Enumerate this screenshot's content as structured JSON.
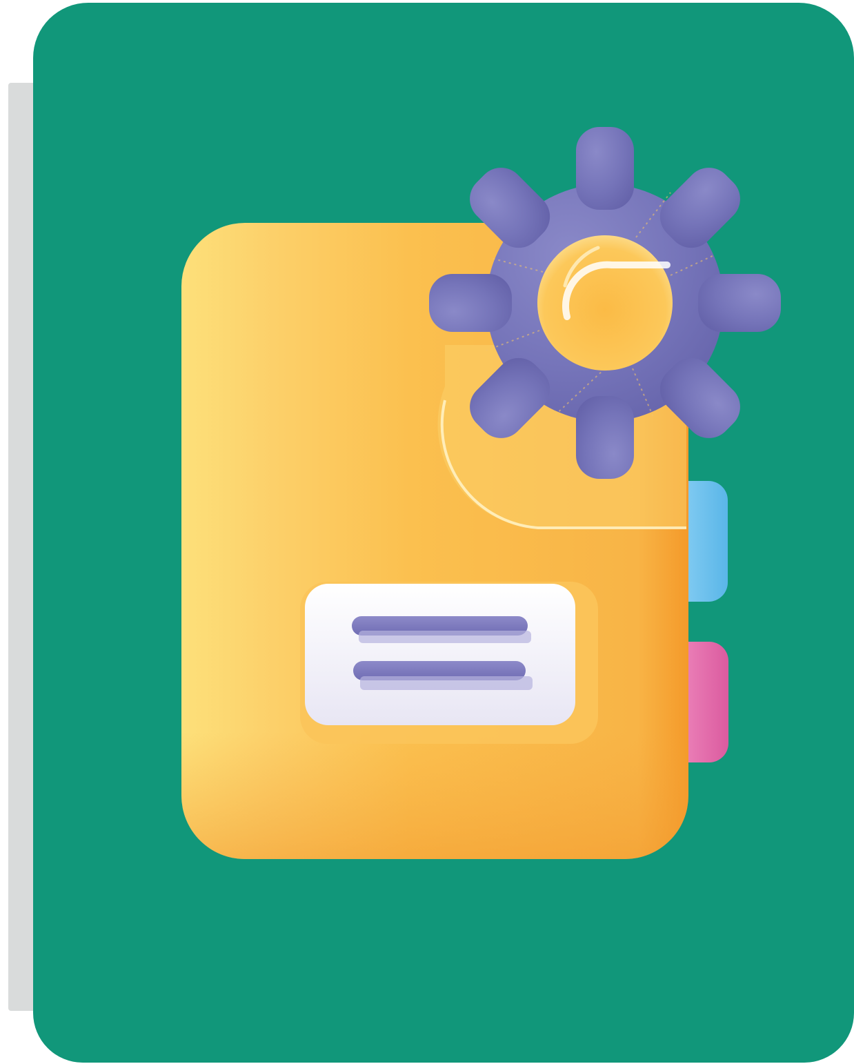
{
  "illustration": {
    "subject": "settings-document-icon",
    "colors": {
      "card_background": "#11977a",
      "card_shadow": "#d9dbdb",
      "folder_light": "#fde07a",
      "folder_mid": "#fbc04f",
      "folder_dark": "#f49a2a",
      "gear": "#7574b9",
      "gear_light": "#8a89c8",
      "label_card": "#f4f3fb",
      "label_lines": "#7b78bd",
      "tab_blue": "#6cc3ef",
      "tab_pink": "#e46cab"
    },
    "icons": [
      "folder-icon",
      "gear-icon",
      "label-card-icon",
      "blue-tab",
      "pink-tab"
    ]
  }
}
